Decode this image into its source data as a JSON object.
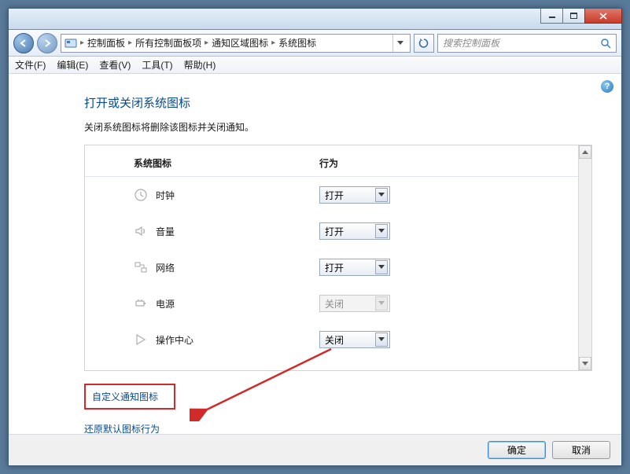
{
  "titlebar": {},
  "breadcrumb": {
    "root": "控制面板",
    "all_items": "所有控制面板项",
    "notif_icons": "通知区域图标",
    "sys_icons": "系统图标"
  },
  "search": {
    "placeholder": "搜索控制面板"
  },
  "menubar": {
    "file": "文件(F)",
    "edit": "编辑(E)",
    "view": "查看(V)",
    "tools": "工具(T)",
    "help": "帮助(H)"
  },
  "page": {
    "heading": "打开或关闭系统图标",
    "subtext": "关闭系统图标将删除该图标并关闭通知。"
  },
  "table": {
    "col_icon": "系统图标",
    "col_behavior": "行为",
    "rows": [
      {
        "label": "时钟",
        "value": "打开",
        "disabled": false
      },
      {
        "label": "音量",
        "value": "打开",
        "disabled": false
      },
      {
        "label": "网络",
        "value": "打开",
        "disabled": false
      },
      {
        "label": "电源",
        "value": "关闭",
        "disabled": true
      },
      {
        "label": "操作中心",
        "value": "关闭",
        "disabled": false
      }
    ]
  },
  "links": {
    "customize": "自定义通知图标",
    "restore": "还原默认图标行为"
  },
  "footer": {
    "ok": "确定",
    "cancel": "取消"
  },
  "help_glyph": "?"
}
